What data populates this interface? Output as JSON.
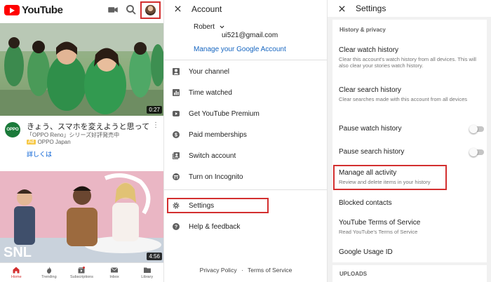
{
  "youtube": {
    "logo_text": "YouTube",
    "video1": {
      "duration": "0:27",
      "channel_badge": "OPPO",
      "title": "きょう、スマホを変えようと思って",
      "subtitle": "「OPPO Reno」シリーズ好評発売中",
      "ad_label": "Ad",
      "channel": "OPPO Japan",
      "cta": "詳しくは"
    },
    "video2": {
      "duration": "4:56",
      "logo": "SNL"
    },
    "nav": [
      {
        "label": "Home",
        "icon": "home-icon"
      },
      {
        "label": "Trending",
        "icon": "flame-icon"
      },
      {
        "label": "Subscriptions",
        "icon": "subscriptions-icon"
      },
      {
        "label": "Inbox",
        "icon": "mail-icon"
      },
      {
        "label": "Library",
        "icon": "folder-icon"
      }
    ]
  },
  "account": {
    "title": "Account",
    "user_name": "Robert",
    "email": "ui521@gmail.com",
    "manage_link": "Manage your Google Account",
    "menu": [
      {
        "label": "Your channel",
        "icon": "person-icon"
      },
      {
        "label": "Time watched",
        "icon": "bar-chart-icon"
      },
      {
        "label": "Get YouTube Premium",
        "icon": "play-icon"
      },
      {
        "label": "Paid memberships",
        "icon": "dollar-icon"
      },
      {
        "label": "Switch account",
        "icon": "switch-account-icon"
      },
      {
        "label": "Turn on Incognito",
        "icon": "incognito-icon"
      },
      {
        "label": "Settings",
        "icon": "gear-icon"
      },
      {
        "label": "Help & feedback",
        "icon": "help-icon"
      }
    ],
    "footer_privacy": "Privacy Policy",
    "footer_sep": "·",
    "footer_terms": "Terms of Service"
  },
  "settings": {
    "title": "Settings",
    "section_history": "History & privacy",
    "items": [
      {
        "title": "Clear watch history",
        "desc": "Clear this account's watch history from all devices. This will also clear your stories watch history."
      },
      {
        "title": "Clear search history",
        "desc": "Clear searches made with this account from all devices"
      },
      {
        "title": "Pause watch history",
        "desc": ""
      },
      {
        "title": "Pause search history",
        "desc": ""
      },
      {
        "title": "Manage all activity",
        "desc": "Review and delete items in your history"
      },
      {
        "title": "Blocked contacts",
        "desc": ""
      },
      {
        "title": "YouTube Terms of Service",
        "desc": "Read YouTube's Terms of Service"
      },
      {
        "title": "Google Usage ID",
        "desc": ""
      }
    ],
    "section_uploads": "UPLOADS"
  },
  "colors": {
    "accent": "#d32f2f",
    "link": "#1565c0",
    "youtube_red": "#ff0000"
  }
}
